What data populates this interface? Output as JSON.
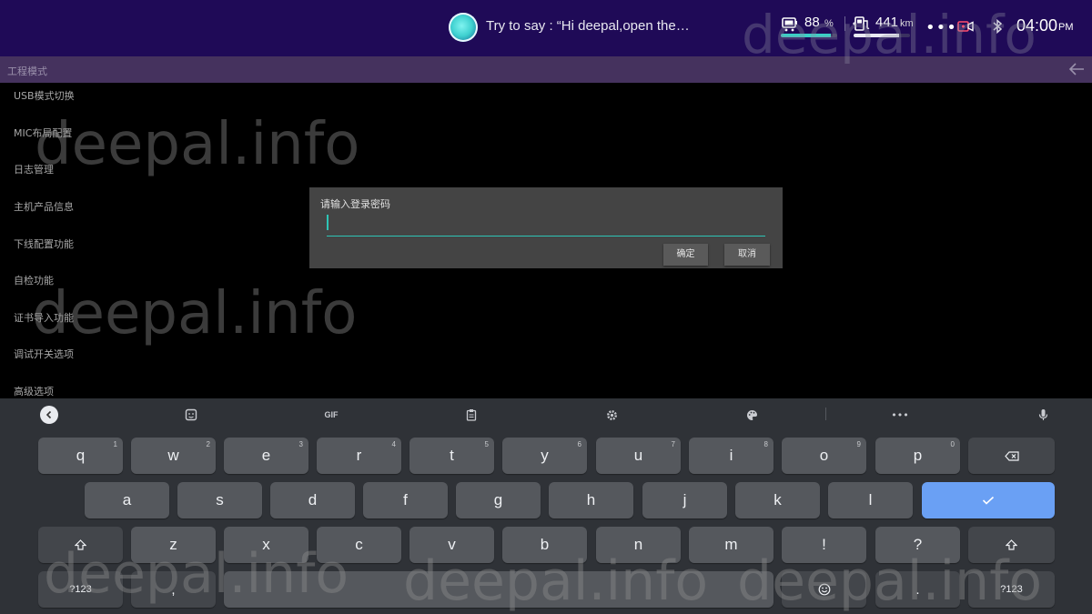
{
  "status_bar": {
    "assistant_hint": "Try to say : “Hi deepal,open the…",
    "battery_value": "88",
    "battery_unit": "%",
    "battery_level": 0.88,
    "range_value": "441",
    "range_unit": "km",
    "range_level": 0.8,
    "time": "04:00",
    "time_ampm": "PM",
    "colors": {
      "background": "#1f0a57",
      "accent": "#39d0c6"
    }
  },
  "titlebar": {
    "title": "工程模式",
    "back_icon": "back-arrow-icon"
  },
  "menu": {
    "items": [
      "USB模式切换",
      "MIC布局配置",
      "日志管理",
      "主机产品信息",
      "下线配置功能",
      "自检功能",
      "证书导入功能",
      "调试开关选项",
      "高级选项"
    ]
  },
  "dialog": {
    "title": "请输入登录密码",
    "input_value": "",
    "ok_label": "确定",
    "cancel_label": "取消",
    "colors": {
      "accent": "#2ec4b6"
    }
  },
  "keyboard": {
    "toolbar": {
      "gif_label": "GIF",
      "icons": [
        "collapse-icon",
        "sticker-icon",
        "gif-icon",
        "clipboard-icon",
        "settings-icon",
        "palette-icon",
        "more-icon",
        "mic-icon"
      ]
    },
    "row1": [
      {
        "k": "q",
        "h": "1"
      },
      {
        "k": "w",
        "h": "2"
      },
      {
        "k": "e",
        "h": "3"
      },
      {
        "k": "r",
        "h": "4"
      },
      {
        "k": "t",
        "h": "5"
      },
      {
        "k": "y",
        "h": "6"
      },
      {
        "k": "u",
        "h": "7"
      },
      {
        "k": "i",
        "h": "8"
      },
      {
        "k": "o",
        "h": "9"
      },
      {
        "k": "p",
        "h": "0"
      }
    ],
    "row2": [
      "a",
      "s",
      "d",
      "f",
      "g",
      "h",
      "j",
      "k",
      "l"
    ],
    "row3": [
      "z",
      "x",
      "c",
      "v",
      "b",
      "n",
      "m",
      "!",
      "?"
    ],
    "symbols_label": "?123",
    "comma": ",",
    "period": ".",
    "enter_color": "#6aa0f4"
  },
  "watermark": "deepal.info"
}
